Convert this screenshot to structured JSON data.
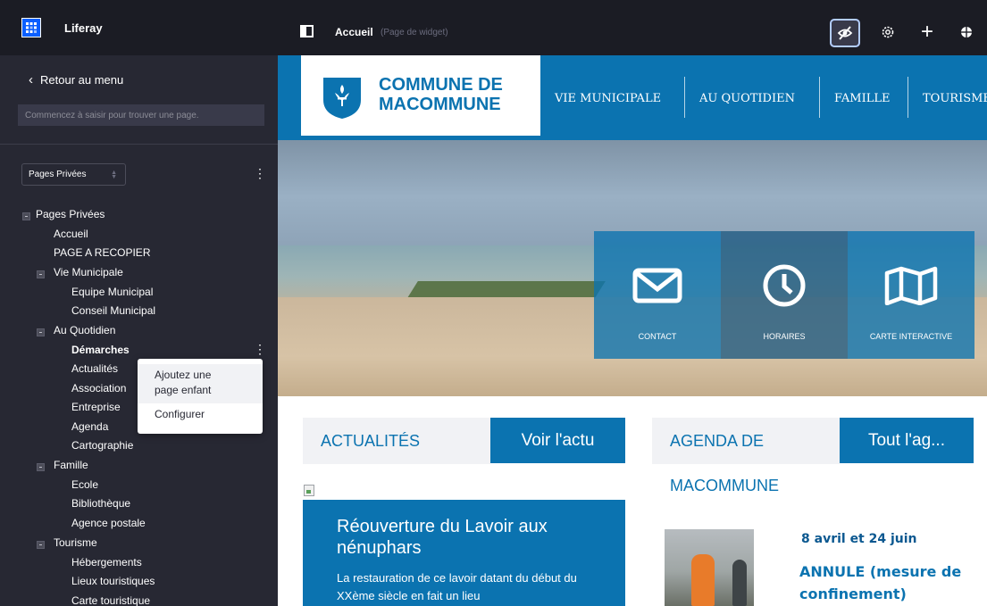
{
  "sidebar": {
    "brand": "Liferay",
    "back_label": "Retour au menu",
    "search_placeholder": "Commencez à saisir pour trouver une page.",
    "page_set": "Pages Privées",
    "tree": {
      "root": "Pages Privées",
      "accueil": "Accueil",
      "page_a_recopier": "PAGE A RECOPIER",
      "vie_municipale": "Vie Municipale",
      "equipe_municipal": "Equipe Municipal",
      "conseil_municipal": "Conseil Municipal",
      "au_quotidien": "Au Quotidien",
      "demarches": "Démarches",
      "actualites": "Actualités",
      "association": "Association",
      "entreprise": "Entreprise",
      "agenda": "Agenda",
      "cartographie": "Cartographie",
      "famille": "Famille",
      "ecole": "Ecole",
      "bibliotheque": "Bibliothèque",
      "agence_postale": "Agence postale",
      "tourisme": "Tourisme",
      "hebergements": "Hébergements",
      "lieux_touristiques": "Lieux touristiques",
      "carte_touristique": "Carte touristique"
    },
    "context_menu": {
      "add_child_line1": "Ajoutez une",
      "add_child_line2": "page enfant",
      "configure": "Configurer"
    }
  },
  "topbar": {
    "title": "Accueil",
    "subtitle": "(Page de widget)",
    "icons": [
      "panel-icon",
      "preview-icon",
      "gear-icon",
      "plus-icon",
      "simulation-icon"
    ]
  },
  "site": {
    "logo_line1": "COMMUNE DE",
    "logo_line2": "MACOMMUNE",
    "nav": [
      "VIE MUNICIPALE",
      "AU QUOTIDIEN",
      "FAMILLE",
      "TOURISME"
    ]
  },
  "quicklinks": [
    "CONTACT",
    "HORAIRES",
    "CARTE INTERACTIVE"
  ],
  "news": {
    "heading": "ACTUALITÉS",
    "button": "Voir l'actu",
    "card_title": "Réouverture du Lavoir aux nénuphars",
    "card_excerpt": "La restauration de ce lavoir datant du début du XXème siècle en fait un lieu"
  },
  "agenda": {
    "heading": "AGENDA DE",
    "heading_line2": "MACOMMUNE",
    "button": "Tout l'ag...",
    "event_date": "8 avril et 24 juin",
    "event_title": "ANNULE (mesure de confinement)"
  },
  "colors": {
    "sidebar_bg": "#272833",
    "topbar_bg": "#1b1c24",
    "brand_blue": "#0b73b0",
    "liferay_blue": "#0b5fff"
  }
}
